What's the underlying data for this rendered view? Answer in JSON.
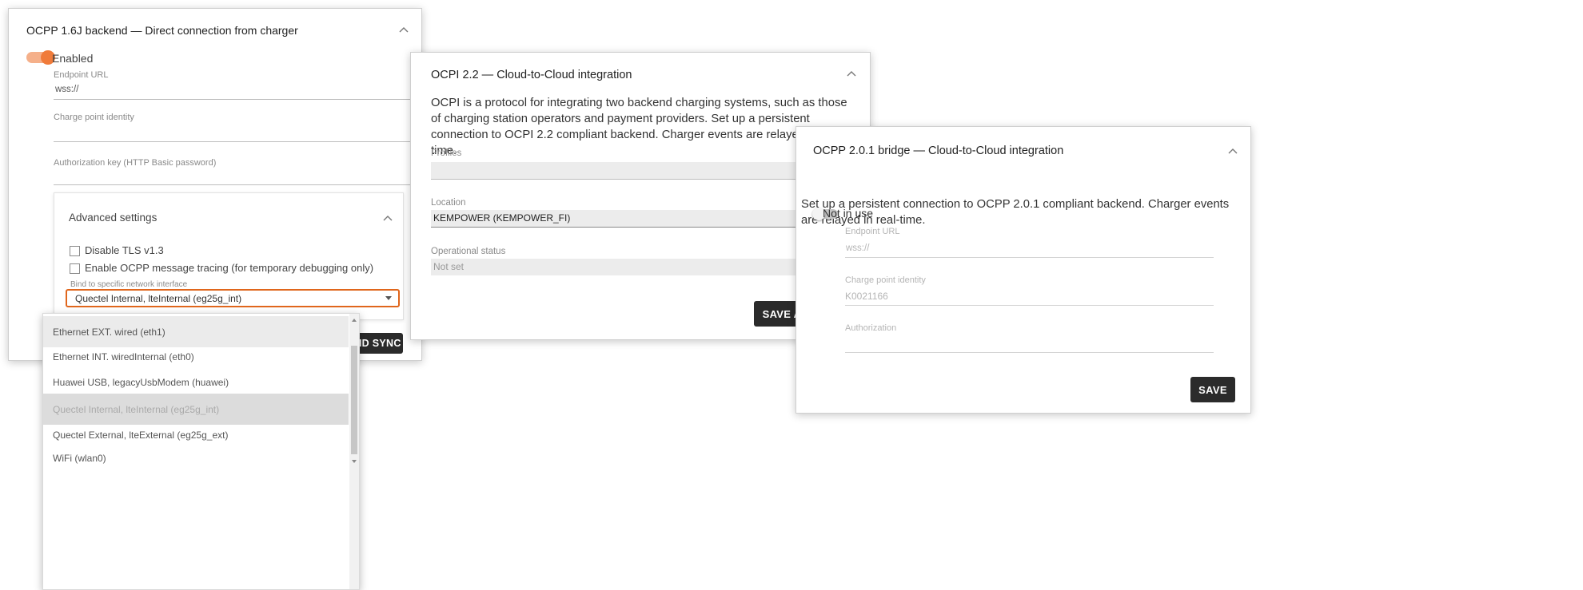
{
  "ocpp16": {
    "title": "OCPP 1.6J backend — Direct connection from charger",
    "enabled_label": "Enabled",
    "endpoint_label": "Endpoint URL",
    "endpoint_value": "wss://",
    "charge_point_label": "Charge point identity",
    "auth_label": "Authorization key (HTTP Basic password)",
    "advanced": {
      "title": "Advanced settings",
      "disable_tls_label": "Disable TLS v1.3",
      "tracing_label": "Enable OCPP message tracing (for temporary debugging only)",
      "bind_label": "Bind to specific network interface",
      "bind_value": "Quectel Internal, lteInternal (eg25g_int)"
    },
    "save_sync_label": "ND SYNC"
  },
  "dropdown": {
    "options": [
      "Ethernet EXT. wired (eth1)",
      "Ethernet INT. wiredInternal (eth0)",
      "Huawei USB, legacyUsbModem (huawei)",
      "Quectel Internal, lteInternal (eg25g_int)",
      "Quectel External, lteExternal (eg25g_ext)",
      "WiFi (wlan0)"
    ],
    "selected_index": 3
  },
  "ocpi": {
    "title": "OCPI 2.2 — Cloud-to-Cloud integration",
    "description": "OCPI is a protocol for integrating two backend charging systems, such as those of charging station operators and payment providers. Set up a persistent connection to OCPI 2.2 compliant backend. Charger events are relayed in real-time.",
    "profiles_label": "Profiles",
    "location_label": "Location",
    "location_value": "KEMPOWER (KEMPOWER_FI)",
    "op_status_label": "Operational status",
    "op_status_value": "Not set",
    "save_label": "SAVE A"
  },
  "ocpp201": {
    "title": "OCPP 2.0.1 bridge — Cloud-to-Cloud integration",
    "description": "Set up a persistent connection to OCPP 2.0.1 compliant backend. Charger events are relayed in real-time.",
    "toggle_label": "Not in use",
    "endpoint_label": "Endpoint URL",
    "endpoint_value": "wss://",
    "charge_point_label": "Charge point identity",
    "charge_point_value": "K0021166",
    "auth_label": "Authorization",
    "save_label": "SAVE"
  },
  "colors": {
    "accent_orange": "#f07b3a",
    "highlight_border": "#e0661c",
    "button_dark": "#2b2b2b"
  }
}
